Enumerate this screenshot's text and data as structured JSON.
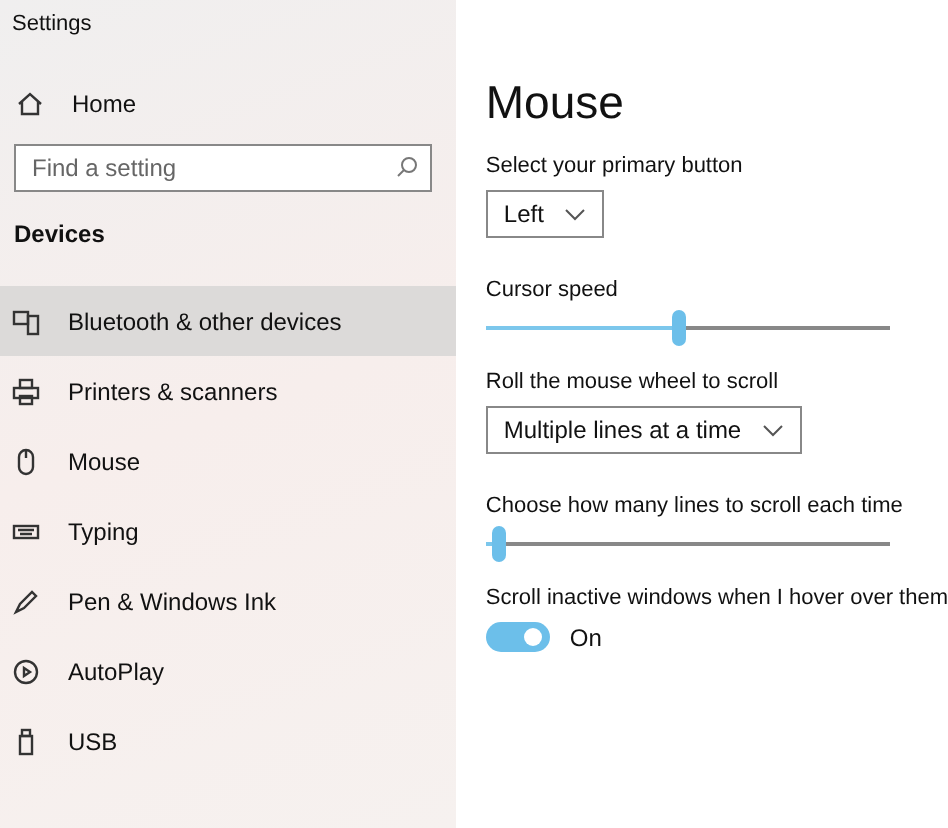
{
  "window": {
    "title": "Settings"
  },
  "sidebar": {
    "home": "Home",
    "search": {
      "placeholder": "Find a setting"
    },
    "section": "Devices",
    "items": [
      {
        "label": "Bluetooth & other devices",
        "selected": true
      },
      {
        "label": "Printers & scanners",
        "selected": false
      },
      {
        "label": "Mouse",
        "selected": false
      },
      {
        "label": "Typing",
        "selected": false
      },
      {
        "label": "Pen & Windows Ink",
        "selected": false
      },
      {
        "label": "AutoPlay",
        "selected": false
      },
      {
        "label": "USB",
        "selected": false
      }
    ]
  },
  "page": {
    "title": "Mouse",
    "settings": [
      {
        "kind": "dropdown",
        "label": "Select your primary button",
        "value": "Left"
      },
      {
        "kind": "slider",
        "label": "Cursor speed",
        "level": 0.475
      },
      {
        "kind": "dropdown",
        "label": "Roll the mouse wheel to scroll",
        "value": "Multiple lines at a time"
      },
      {
        "kind": "slider",
        "label": "Choose how many lines to scroll each time",
        "level": 0.03
      },
      {
        "kind": "toggle",
        "label": "Scroll inactive windows when I hover over them",
        "on": true,
        "state": "On"
      }
    ]
  }
}
